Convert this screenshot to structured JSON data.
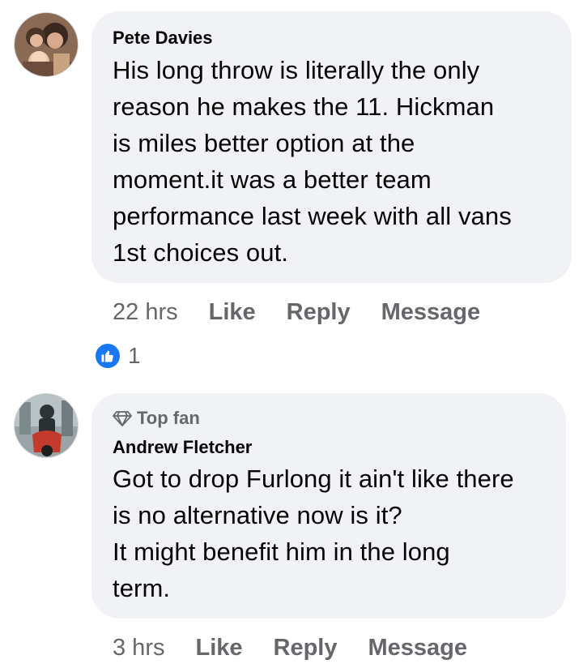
{
  "comments": [
    {
      "author": "Pete Davies",
      "lines": [
        "His long throw is literally the only",
        "reason he makes the 11. Hickman",
        "is miles better option at the",
        "moment.it was a better team",
        "performance last week with all vans",
        "1st choices out."
      ],
      "time": "22 hrs",
      "like_label": "Like",
      "reply_label": "Reply",
      "message_label": "Message",
      "reaction_icon": "like-icon",
      "reaction_count": "1"
    },
    {
      "badge": "Top fan",
      "badge_icon": "diamond-icon",
      "author": "Andrew Fletcher",
      "lines": [
        "Got to drop Furlong it ain't like there",
        "is no alternative now is it?",
        "It might benefit him in the long",
        "term."
      ],
      "time": "3 hrs",
      "like_label": "Like",
      "reply_label": "Reply",
      "message_label": "Message"
    }
  ],
  "colors": {
    "bubble": "#f0f2f5",
    "text": "#050505",
    "secondary": "#65676b",
    "like_blue": "#1877f2"
  }
}
